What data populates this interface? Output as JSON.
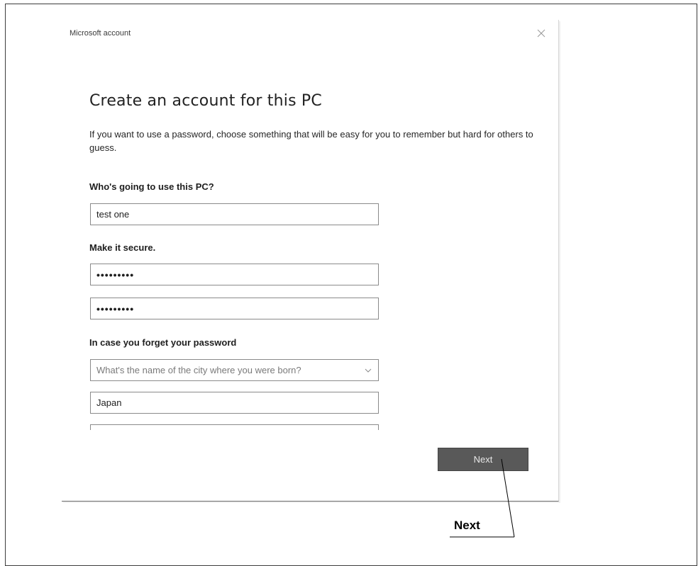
{
  "dialog": {
    "title": "Microsoft account",
    "heading": "Create an account for this PC",
    "intro": "If you want to use a password, choose something that will be easy for you to remember but hard for others to guess."
  },
  "user_section": {
    "label": "Who's going to use this PC?",
    "username_value": "test one"
  },
  "secure_section": {
    "label": "Make it secure.",
    "password_value": "•••••••••",
    "reenter_value": "•••••••••"
  },
  "recovery_section": {
    "label": "In case you forget your password",
    "question_selected": "What's the name of the city where you were born?",
    "answer_value": "Japan",
    "third_field_value": ""
  },
  "buttons": {
    "next_label": "Next"
  },
  "callout": {
    "label": "Next"
  },
  "icons": {
    "close": "close-icon",
    "dropdown": "chevron-down-icon"
  },
  "colors": {
    "next_button_bg": "#595959",
    "field_border": "#8a8a8a"
  }
}
